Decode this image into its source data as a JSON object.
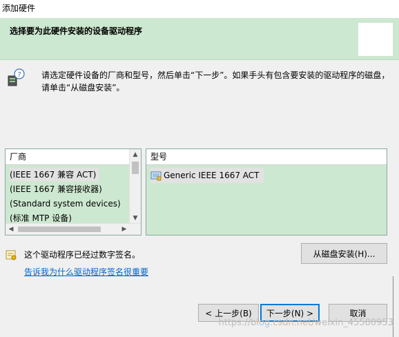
{
  "window": {
    "title": "添加硬件"
  },
  "header": {
    "title": "选择要为此硬件安装的设备驱动程序"
  },
  "instruction": "请选定硬件设备的厂商和型号，然后单击“下一步”。如果手头有包含要安装的驱动程序的磁盘，请单击“从磁盘安装”。",
  "manufacturer_list": {
    "header": "厂商",
    "items": [
      "(IEEE 1667 兼容 ACT)",
      "(IEEE 1667 兼容接收器)",
      "(Standard system devices)",
      "(标准 MTP 设备)"
    ],
    "selected_index": 0
  },
  "model_list": {
    "header": "型号",
    "items": [
      "Generic IEEE 1667 ACT"
    ]
  },
  "signature": {
    "text": "这个驱动程序已经过数字签名。",
    "link": "告诉我为什么驱动程序签名很重要"
  },
  "buttons": {
    "have_disk": "从磁盘安装(H)...",
    "back": "< 上一步(B)",
    "next": "下一步(N) >",
    "cancel": "取消"
  },
  "watermark": "https://blog.csdn.net/weixin_45580953",
  "colors": {
    "accent_green": "#cde8d0",
    "link_blue": "#0066cc",
    "focus_blue": "#0078d7"
  }
}
